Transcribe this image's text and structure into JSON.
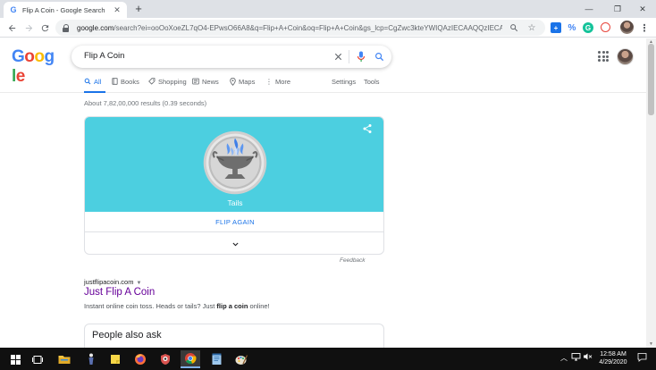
{
  "browser": {
    "tab_title": "Flip A Coin - Google Search",
    "tab_favicon": "G",
    "new_tab_label": "+",
    "url_host": "google.com",
    "url_rest": "/search?ei=ooOoXoeZL7qO4-EPwsO66A8&q=Flip+A+Coin&oq=Flip+A+Coin&gs_lcp=CgZwc3kteYWIQAzIECAAQQzIECAAQ..."
  },
  "search": {
    "query": "Flip A Coin",
    "logo_letters": [
      "G",
      "o",
      "o",
      "g",
      "l",
      "e"
    ]
  },
  "nav_tabs": [
    {
      "label": "All",
      "icon": "search-icon"
    },
    {
      "label": "Books",
      "icon": "book-icon"
    },
    {
      "label": "Shopping",
      "icon": "tag-icon"
    },
    {
      "label": "News",
      "icon": "news-icon"
    },
    {
      "label": "Maps",
      "icon": "map-pin-icon"
    },
    {
      "label": "More",
      "icon": "more-vertical-icon"
    }
  ],
  "nav_right": {
    "settings": "Settings",
    "tools": "Tools"
  },
  "stats": "About 7,82,00,000 results (0.39 seconds)",
  "coin_card": {
    "result": "Tails",
    "flip_again": "FLIP AGAIN",
    "feedback": "Feedback",
    "background_color": "#4ccfe0"
  },
  "result": {
    "cite": "justflipacoin.com",
    "title": "Just Flip A Coin",
    "snippet_pre": "Instant online coin toss. Heads or tails? Just ",
    "snippet_bold": "flip a coin",
    "snippet_post": " online!"
  },
  "people_also_ask": {
    "title": "People also ask"
  },
  "taskbar": {
    "time": "12:58 AM",
    "date": "4/29/2020"
  }
}
